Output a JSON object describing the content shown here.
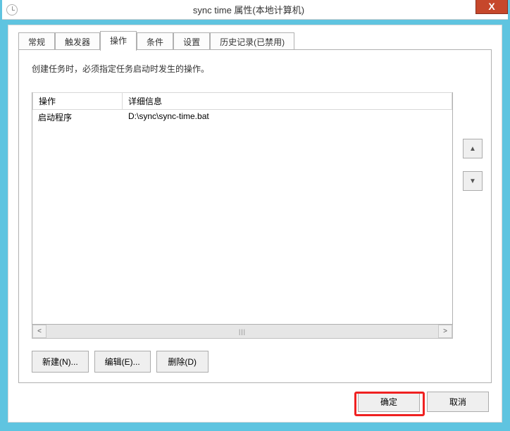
{
  "window": {
    "title": "sync time 属性(本地计算机)"
  },
  "tabs": {
    "general": "常规",
    "triggers": "触发器",
    "actions": "操作",
    "conditions": "条件",
    "settings": "设置",
    "history": "历史记录(已禁用)"
  },
  "panel": {
    "description": "创建任务时，必须指定任务启动时发生的操作。"
  },
  "list": {
    "header_action": "操作",
    "header_detail": "详细信息",
    "rows": [
      {
        "action": "启动程序",
        "detail": "D:\\sync\\sync-time.bat"
      }
    ]
  },
  "buttons": {
    "new": "新建(N)...",
    "edit": "编辑(E)...",
    "delete": "删除(D)",
    "ok": "确定",
    "cancel": "取消"
  },
  "icons": {
    "close": "X",
    "up": "▲",
    "down": "▼",
    "left": "<",
    "right": ">",
    "grip": "|||"
  }
}
